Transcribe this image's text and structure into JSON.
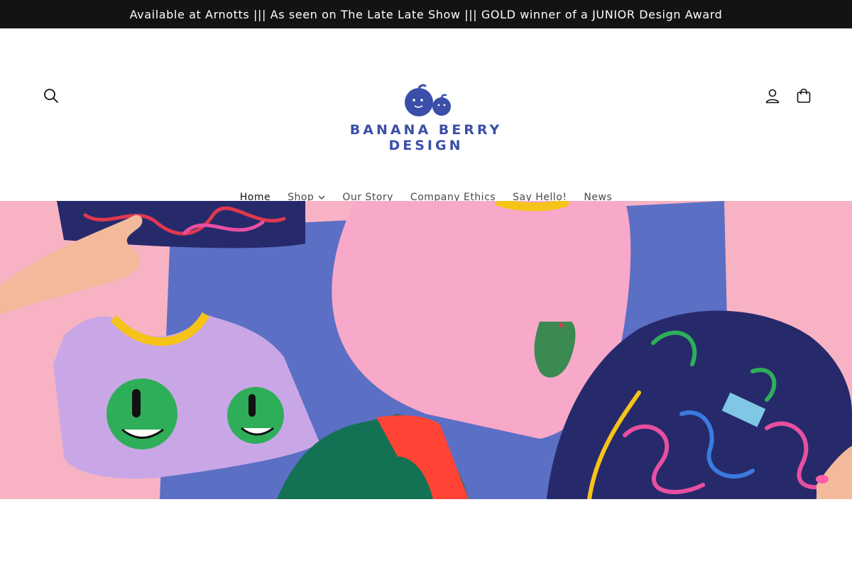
{
  "announcement": {
    "text": "Available at Arnotts ||| As seen on The Late Late Show ||| GOLD winner of a JUNIOR Design Award"
  },
  "header": {
    "logo": {
      "line1": "BANANA BERRY",
      "line2": "DESIGN",
      "icon": "berry-faces-icon"
    },
    "icons": {
      "search": "search-icon",
      "account": "user-icon",
      "cart": "bag-icon"
    }
  },
  "nav": {
    "items": [
      {
        "label": "Home",
        "active": true
      },
      {
        "label": "Shop",
        "dropdown": true
      },
      {
        "label": "Our Story"
      },
      {
        "label": "Company Ethics"
      },
      {
        "label": "Say Hello!"
      },
      {
        "label": "News"
      }
    ]
  },
  "hero": {
    "image": "folded-kids-clothing-flatlay"
  },
  "colors": {
    "announcement_bg": "#131313",
    "brand_blue": "#3b4fa8",
    "hero_pink": "#f7b3c3",
    "hero_blue": "#5b6fc4"
  }
}
